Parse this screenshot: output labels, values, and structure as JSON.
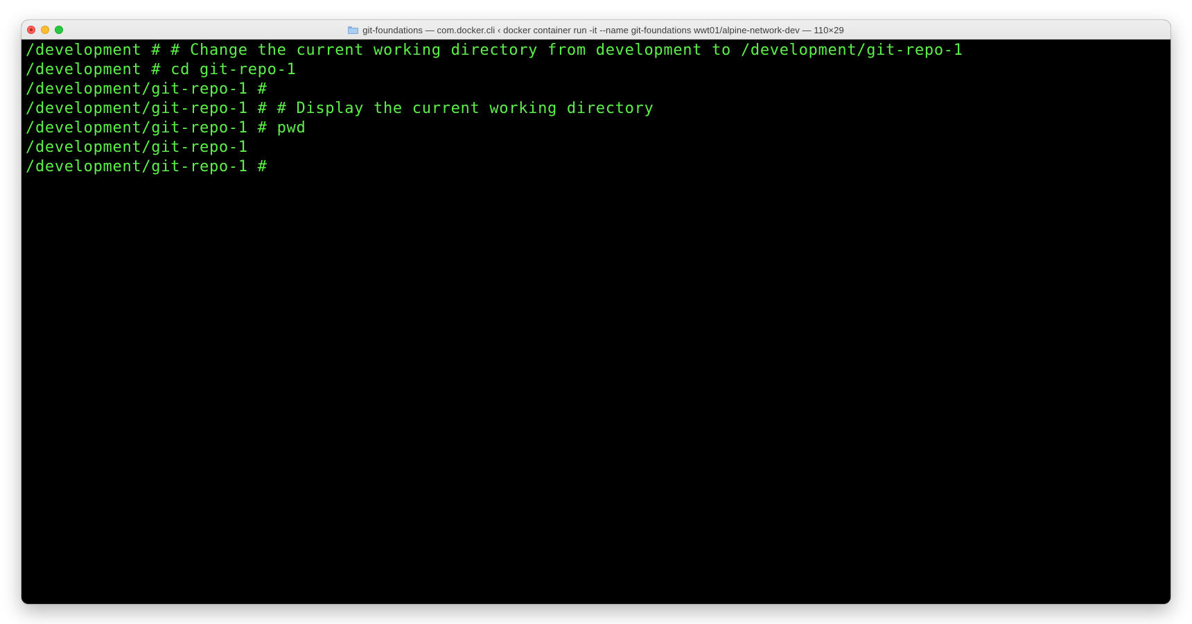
{
  "window": {
    "title": "git-foundations — com.docker.cli ‹ docker container run -it --name git-foundations wwt01/alpine-network-dev — 110×29",
    "title_icon": "folder-icon"
  },
  "colors": {
    "terminal_background": "#000000",
    "terminal_text": "#5ef04a",
    "titlebar": "#e8e8e8",
    "close": "#fe5f57",
    "minimize": "#febc2e",
    "zoom": "#28c840"
  },
  "terminal": {
    "lines": [
      "/development # # Change the current working directory from development to /development/git-repo-1",
      "/development # cd git-repo-1",
      "/development/git-repo-1 #",
      "/development/git-repo-1 # # Display the current working directory",
      "/development/git-repo-1 # pwd",
      "/development/git-repo-1",
      "/development/git-repo-1 #"
    ]
  }
}
